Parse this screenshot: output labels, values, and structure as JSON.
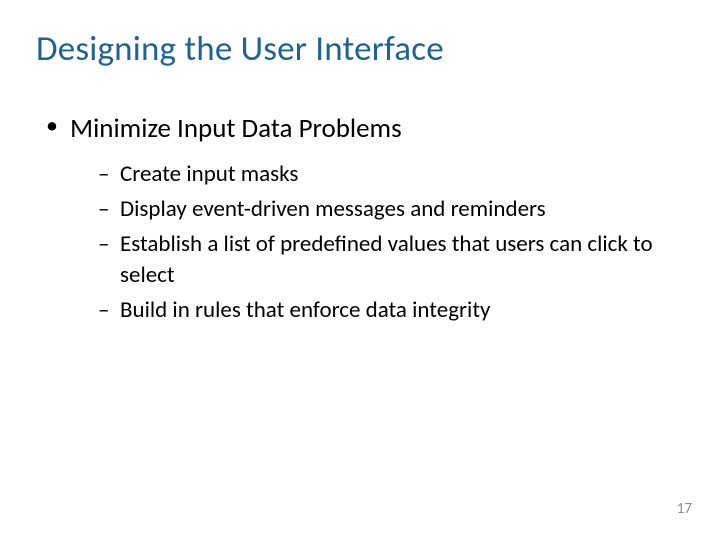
{
  "title": "Designing the User Interface",
  "bullets": {
    "level1": [
      {
        "text": "Minimize Input Data Problems"
      }
    ],
    "level2": [
      {
        "text": "Create input masks"
      },
      {
        "text": "Display event-driven messages and reminders"
      },
      {
        "text": "Establish a list of predefined values that users can click to select"
      },
      {
        "text": "Build in rules that enforce data integrity"
      }
    ]
  },
  "page_number": "17"
}
